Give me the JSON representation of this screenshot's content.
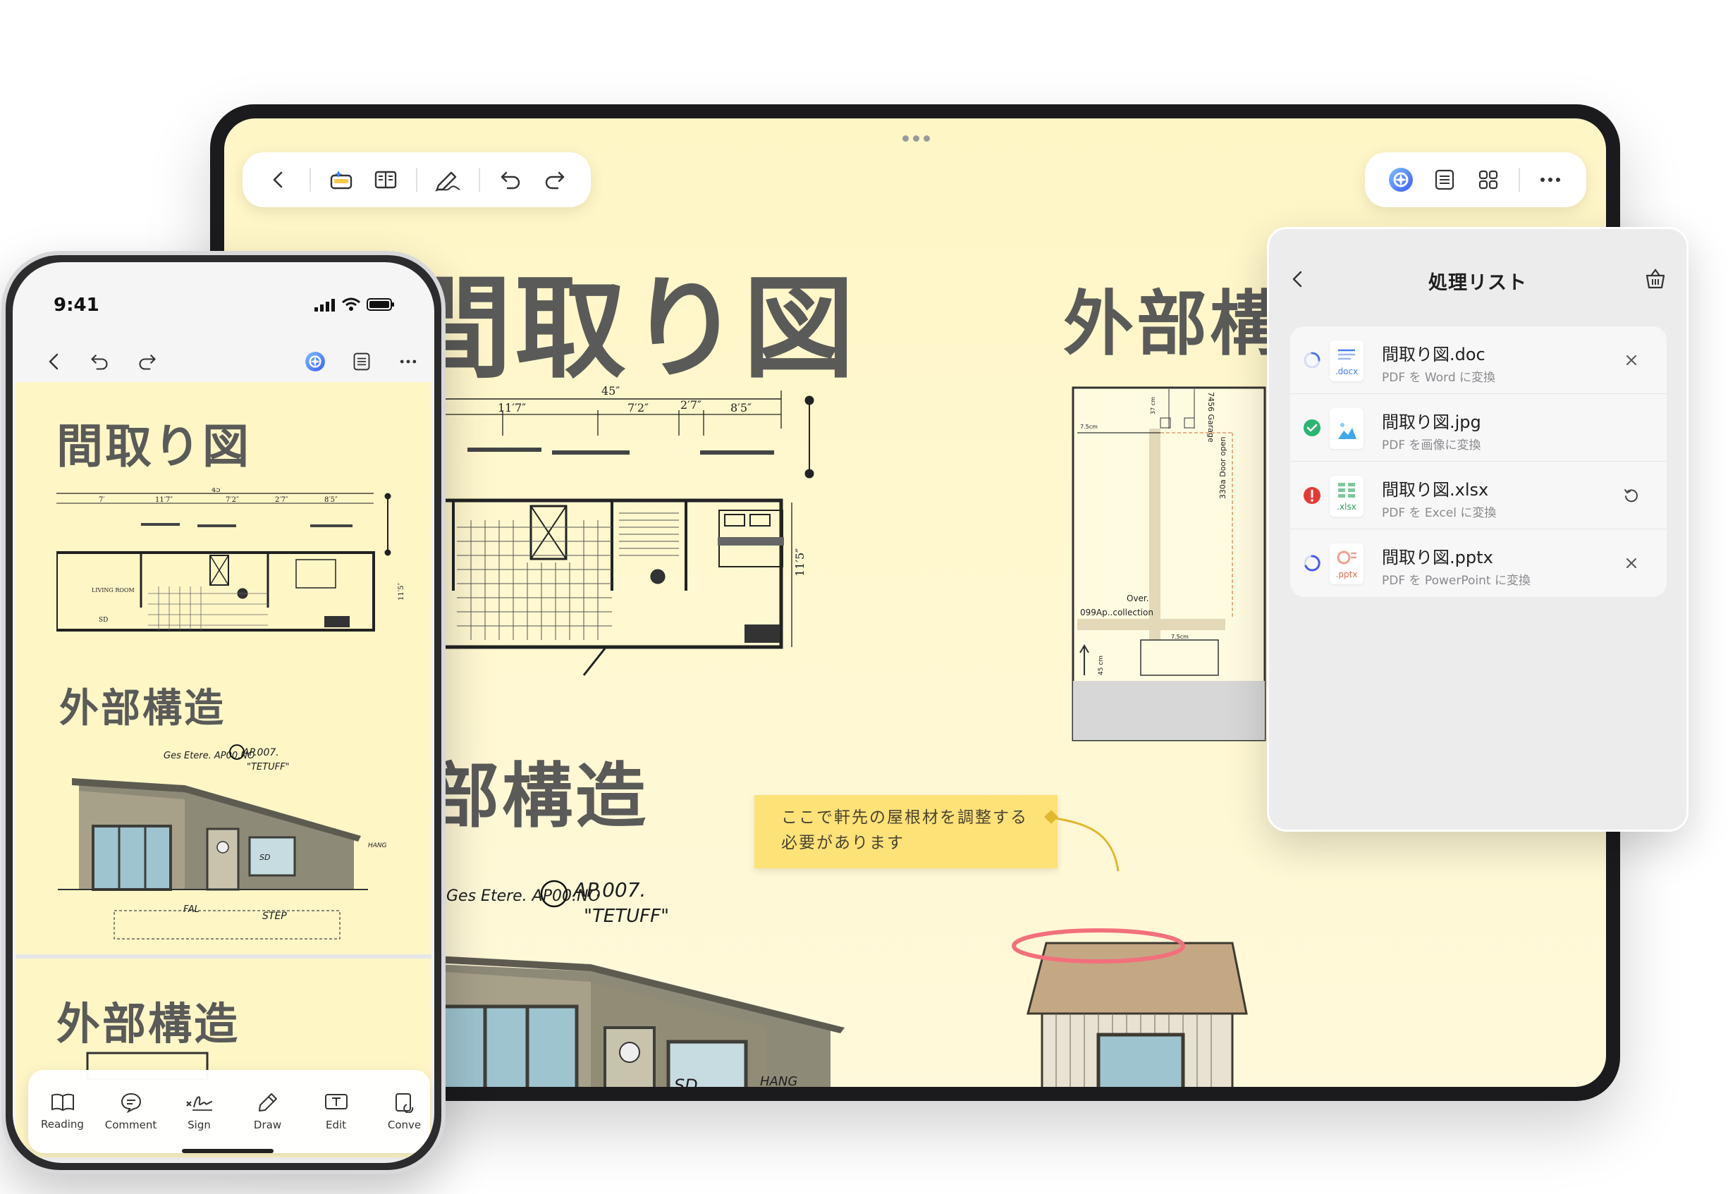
{
  "tablet": {
    "toolbar_left": {
      "icons": [
        "back-icon",
        "ai-toolkit-icon",
        "reader-icon",
        "sign-draw-icon",
        "undo-icon",
        "redo-icon"
      ]
    },
    "toolbar_right": {
      "icons": [
        "ai-assistant-icon",
        "list-icon",
        "grid-icon",
        "more-icon"
      ]
    },
    "document": {
      "title_floorplan": "間取り図",
      "title_exterior_right": "外部構",
      "title_structure": "部構造",
      "plan_labels": {
        "overall": "45″",
        "d1": "11′7″",
        "d2": "7′2″",
        "d3": "2′7″",
        "d4": "8′5″",
        "height": "11′5″"
      },
      "note": "ここで軒先の屋根材を調整する必要があります",
      "elevation_labels": {
        "garage": "7456 Garage",
        "door": "330a Door open",
        "over": "Over.",
        "collection": "099Ap..collection",
        "cm37": "37 cm",
        "cm75": "7.5cm",
        "cm45": "45 cm"
      },
      "sketch_labels": {
        "a1": "Ges Etere. AP00.NO",
        "a2": "AP.007.",
        "a3": "\"TETUFF\"",
        "sd": "SD",
        "hang": "HANG"
      }
    }
  },
  "panel": {
    "title": "処理リスト",
    "items": [
      {
        "name": "間取り図.doc",
        "sub": "PDF を Word に変換",
        "ext": ".docx",
        "status": "processing",
        "action": "close-icon",
        "accent": "#4a7bf0"
      },
      {
        "name": "間取り図.jpg",
        "sub": "PDF を画像に変換",
        "ext": "",
        "status": "done",
        "action": "",
        "accent": "#3fa7e8"
      },
      {
        "name": "間取り図.xlsx",
        "sub": "PDF を Excel に変換",
        "ext": ".xlsx",
        "status": "error",
        "action": "retry-icon",
        "accent": "#2f9a5a"
      },
      {
        "name": "間取り図.pptx",
        "sub": "PDF を PowerPoint に変換",
        "ext": ".pptx",
        "status": "processing",
        "action": "close-icon",
        "accent": "#e2694d"
      }
    ]
  },
  "phone": {
    "time": "9:41",
    "document": {
      "title1": "間取り図",
      "title2": "外部構造",
      "title3": "外部構造",
      "plan_labels": {
        "overall": "45″",
        "d1": "7′",
        "d2": "11′7″",
        "d3": "7′2″",
        "d4": "2′7″",
        "d5": "8′5″",
        "room": "LIVING ROOM",
        "sd": "SD",
        "height": "11′5″"
      },
      "sketch_labels": {
        "a1": "Ges Etere. AP00.NO",
        "a2": "AP.007.",
        "a3": "\"TETUFF\"",
        "fal": "FAL",
        "step": "STEP",
        "sd": "SD",
        "hang": "HANG"
      }
    },
    "bottom_bar": [
      {
        "label": "Reading",
        "icon": "book-icon"
      },
      {
        "label": "Comment",
        "icon": "comment-icon"
      },
      {
        "label": "Sign",
        "icon": "signature-icon"
      },
      {
        "label": "Draw",
        "icon": "pen-icon"
      },
      {
        "label": "Edit",
        "icon": "edit-text-icon"
      },
      {
        "label": "Conve",
        "icon": "convert-icon"
      }
    ]
  },
  "colors": {
    "doc_background": "#fff6c6",
    "note_yellow": "#fde278",
    "ai_accent": "#3b82f6",
    "success": "#2bb673",
    "error": "#e53935",
    "annotation_red": "#f2707c"
  }
}
